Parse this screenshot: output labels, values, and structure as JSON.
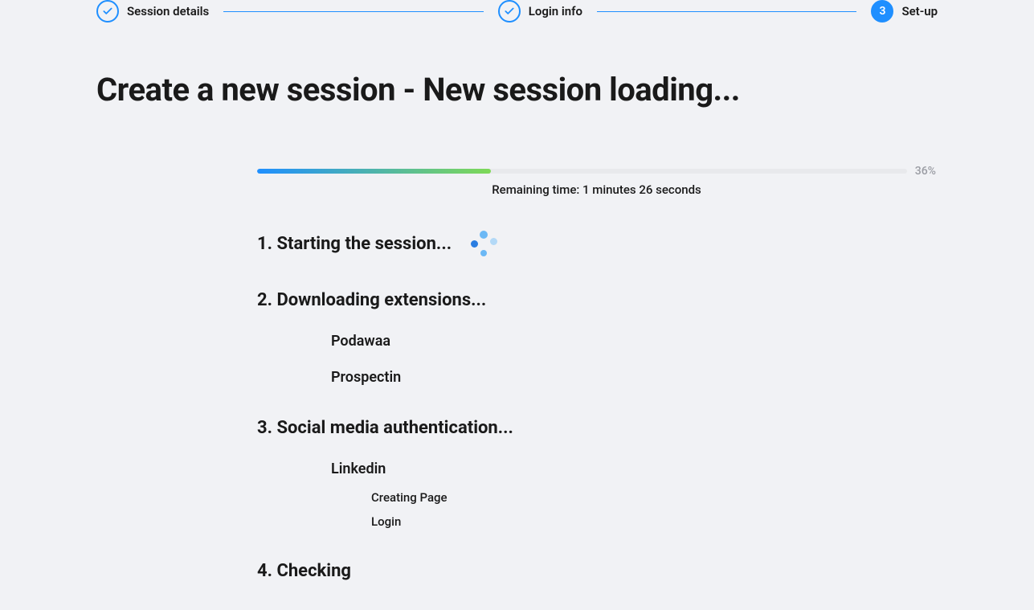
{
  "stepper": {
    "steps": [
      {
        "label": "Session details",
        "state": "done"
      },
      {
        "label": "Login info",
        "state": "done"
      },
      {
        "label": "Set-up",
        "state": "active",
        "number": "3"
      }
    ]
  },
  "title": "Create a new session - New session loading...",
  "progress": {
    "percent_label": "36%",
    "remaining_label": "Remaining time: 1 minutes 26 seconds"
  },
  "steps": {
    "s1": {
      "title": "1. Starting the session..."
    },
    "s2": {
      "title": "2. Downloading extensions...",
      "items": [
        "Podawaa",
        "Prospectin"
      ]
    },
    "s3": {
      "title": "3. Social media authentication...",
      "items": [
        {
          "name": "Linkedin",
          "subs": [
            "Creating Page",
            "Login"
          ]
        }
      ]
    },
    "s4": {
      "title": "4. Checking"
    }
  }
}
